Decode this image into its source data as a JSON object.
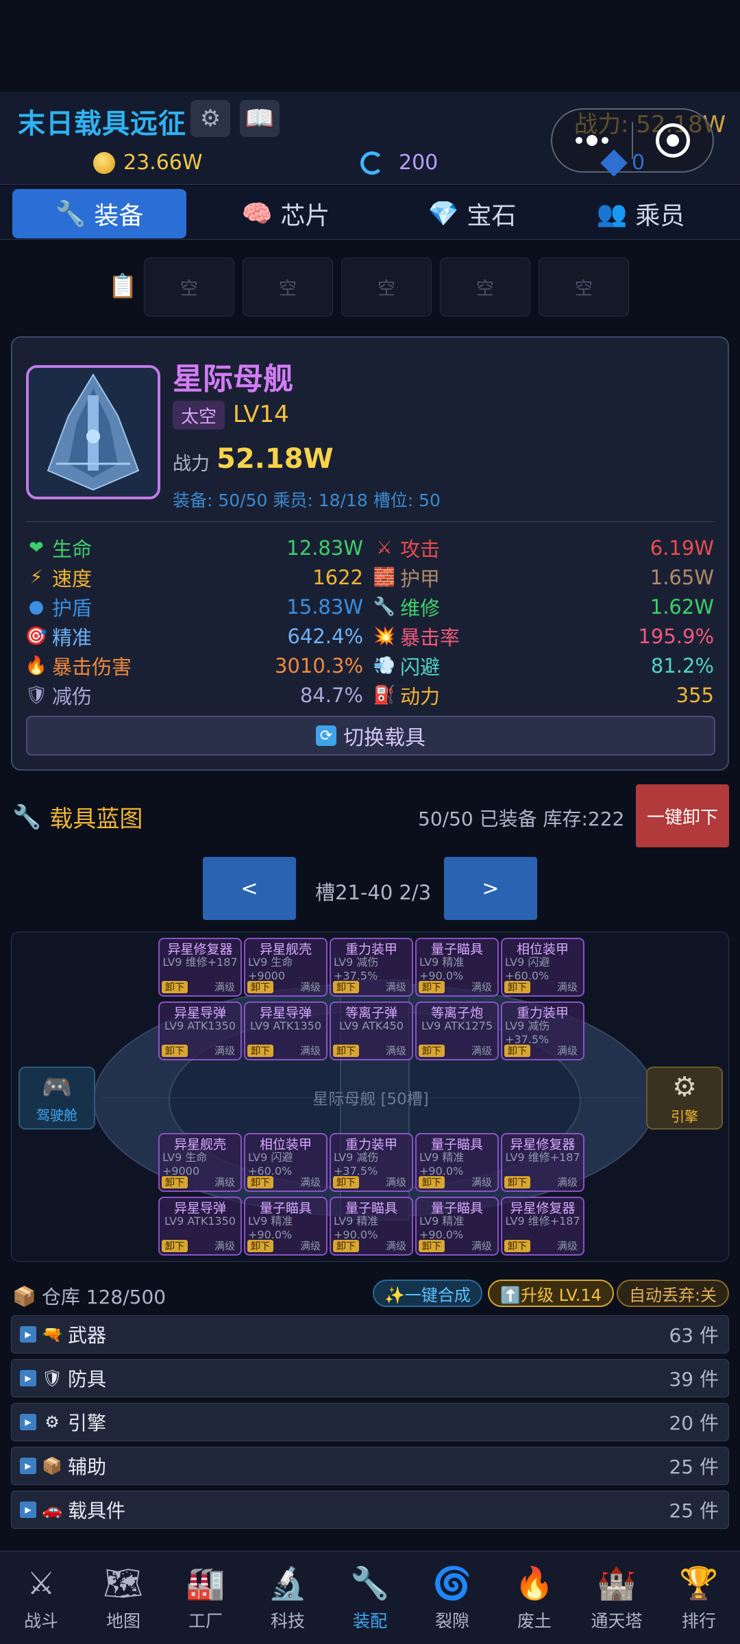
{
  "header": {
    "title": "末日载具远征",
    "power": "战力: 52.18W",
    "gold": "23.66W",
    "rift": "200",
    "gems": "0"
  },
  "tabs": [
    {
      "label": "装备",
      "icon": "🔧"
    },
    {
      "label": "芯片",
      "icon": "🧠"
    },
    {
      "label": "宝石",
      "icon": "💎"
    },
    {
      "label": "乘员",
      "icon": "👥"
    }
  ],
  "quick_slots": [
    "空",
    "空",
    "空",
    "空",
    "空"
  ],
  "vehicle": {
    "name": "星际母舰",
    "tag": "太空",
    "level": "LV14",
    "power_label": "战力",
    "power_value": "52.18W",
    "meta": "装备: 50/50  乘员: 18/18  槽位: 50",
    "stats": [
      {
        "label": "生命",
        "value": "12.83W",
        "icon": "❤",
        "color": "#3ecf6a",
        "vcolor": "#3ecf6a"
      },
      {
        "label": "攻击",
        "value": "6.19W",
        "icon": "⚔",
        "color": "#e84d4d",
        "vcolor": "#e84d4d"
      },
      {
        "label": "速度",
        "value": "1622",
        "icon": "⚡",
        "color": "#f2b531",
        "vcolor": "#f2b531"
      },
      {
        "label": "护甲",
        "value": "1.65W",
        "icon": "🧱",
        "color": "#b08a6a",
        "vcolor": "#b08a6a"
      },
      {
        "label": "护盾",
        "value": "15.83W",
        "icon": "●",
        "color": "#3a8fe0",
        "vcolor": "#3a8fe0"
      },
      {
        "label": "维修",
        "value": "1.62W",
        "icon": "🔧",
        "color": "#3ecf6a",
        "vcolor": "#3ecf6a"
      },
      {
        "label": "精准",
        "value": "642.4%",
        "icon": "🎯",
        "color": "#6fb2f5",
        "vcolor": "#6fb2f5"
      },
      {
        "label": "暴击率",
        "value": "195.9%",
        "icon": "💥",
        "color": "#ef5a7a",
        "vcolor": "#ef5a7a"
      },
      {
        "label": "暴击伤害",
        "value": "3010.3%",
        "icon": "🔥",
        "color": "#f08a3a",
        "vcolor": "#f08a3a"
      },
      {
        "label": "闪避",
        "value": "81.2%",
        "icon": "💨",
        "color": "#4fd6c6",
        "vcolor": "#4fd6c6"
      },
      {
        "label": "减伤",
        "value": "84.7%",
        "icon": "🛡",
        "color": "#a9a6d8",
        "vcolor": "#a9a6d8"
      },
      {
        "label": "动力",
        "value": "355",
        "icon": "⛽",
        "color": "#f2b531",
        "vcolor": "#f2b531"
      }
    ],
    "switch_label": "切换载具"
  },
  "blueprint": {
    "title": "载具蓝图",
    "status": "50/50 已装备  库存:222",
    "unload_label": "一键卸下",
    "prev": "<",
    "next": ">",
    "page_info": "槽21-40  2/3",
    "center_label": "星际母舰 [50槽]",
    "cockpit_label": "驾驶舱",
    "engine_label": "引擎",
    "unequip": "卸下",
    "maxed": "满级",
    "rows": [
      [
        {
          "name": "异星修复器",
          "desc": "LV9 维修+187"
        },
        {
          "name": "异星舰壳",
          "desc": "LV9 生命+9000"
        },
        {
          "name": "重力装甲",
          "desc": "LV9 减伤+37.5%"
        },
        {
          "name": "量子瞄具",
          "desc": "LV9 精准+90.0%"
        },
        {
          "name": "相位装甲",
          "desc": "LV9 闪避+60.0%"
        }
      ],
      [
        {
          "name": "异星导弹",
          "desc": "LV9 ATK1350"
        },
        {
          "name": "异星导弹",
          "desc": "LV9 ATK1350"
        },
        {
          "name": "等离子弹",
          "desc": "LV9 ATK450"
        },
        {
          "name": "等离子炮",
          "desc": "LV9 ATK1275"
        },
        {
          "name": "重力装甲",
          "desc": "LV9 减伤+37.5%"
        }
      ],
      [
        {
          "name": "异星舰壳",
          "desc": "LV9 生命+9000"
        },
        {
          "name": "相位装甲",
          "desc": "LV9 闪避+60.0%"
        },
        {
          "name": "重力装甲",
          "desc": "LV9 减伤+37.5%"
        },
        {
          "name": "量子瞄具",
          "desc": "LV9 精准+90.0%"
        },
        {
          "name": "异星修复器",
          "desc": "LV9 维修+187"
        }
      ],
      [
        {
          "name": "异星导弹",
          "desc": "LV9 ATK1350"
        },
        {
          "name": "量子瞄具",
          "desc": "LV9 精准+90.0%"
        },
        {
          "name": "量子瞄具",
          "desc": "LV9 精准+90.0%"
        },
        {
          "name": "量子瞄具",
          "desc": "LV9 精准+90.0%"
        },
        {
          "name": "异星修复器",
          "desc": "LV9 维修+187"
        }
      ]
    ]
  },
  "warehouse": {
    "label": "仓库 128/500",
    "merge": "✨一键合成",
    "upgrade": "⬆️升级 LV.14",
    "auto": "自动丢弃:关",
    "categories": [
      {
        "name": "武器",
        "count": "63 件",
        "icon": "🔫"
      },
      {
        "name": "防具",
        "count": "39 件",
        "icon": "🛡"
      },
      {
        "name": "引擎",
        "count": "20 件",
        "icon": "⚙"
      },
      {
        "name": "辅助",
        "count": "25 件",
        "icon": "📦"
      },
      {
        "name": "载具件",
        "count": "25 件",
        "icon": "🚗"
      }
    ]
  },
  "nav": [
    {
      "label": "战斗",
      "icon": "⚔"
    },
    {
      "label": "地图",
      "icon": "🗺"
    },
    {
      "label": "工厂",
      "icon": "🏭"
    },
    {
      "label": "科技",
      "icon": "🔬"
    },
    {
      "label": "装配",
      "icon": "🔧"
    },
    {
      "label": "裂隙",
      "icon": "🌀"
    },
    {
      "label": "废土",
      "icon": "🔥"
    },
    {
      "label": "通天塔",
      "icon": "🏰"
    },
    {
      "label": "排行",
      "icon": "🏆"
    }
  ]
}
